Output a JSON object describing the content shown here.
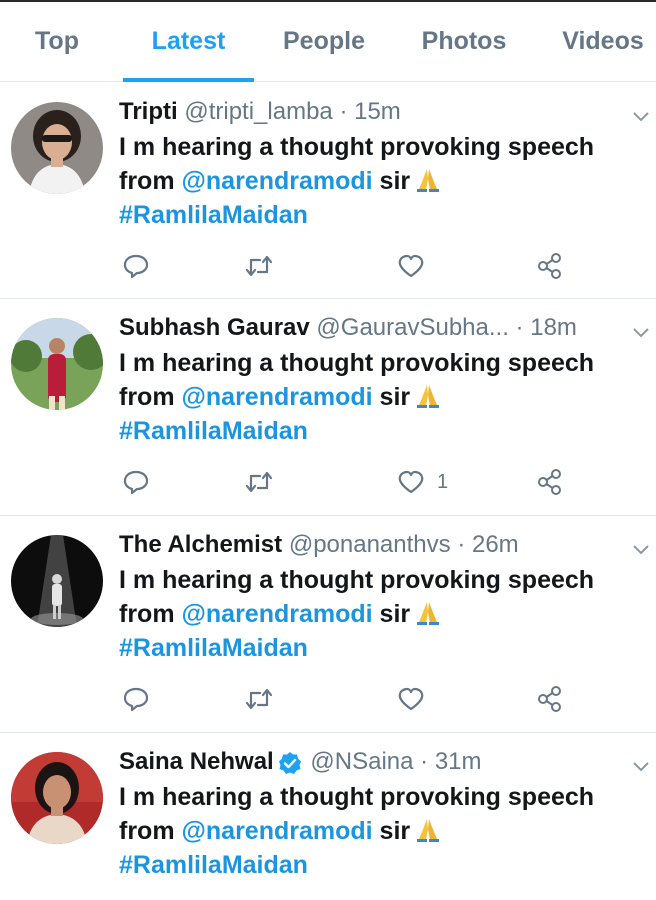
{
  "tabs": [
    {
      "label": "Top",
      "active": false
    },
    {
      "label": "Latest",
      "active": true
    },
    {
      "label": "People",
      "active": false
    },
    {
      "label": "Photos",
      "active": false
    },
    {
      "label": "Videos",
      "active": false
    }
  ],
  "colors": {
    "accent": "#1da1f2",
    "link": "#1b95e0",
    "muted": "#657786",
    "divider": "#e1e8ed",
    "verified": "#1da1f2"
  },
  "tweets": [
    {
      "name": "Tripti",
      "handle": "@tripti_lamba",
      "dot": "·",
      "time": "15m",
      "verified": false,
      "text_1": "I m hearing a thought provoking speech",
      "from": "from",
      "mention": "@narendramodi",
      "sir": "sir",
      "hashtag": "#RamlilaMaidan",
      "emoji": "folded-hands",
      "like_count": ""
    },
    {
      "name": "Subhash Gaurav",
      "handle": "@GauravSubha...",
      "dot": "·",
      "time": "18m",
      "verified": false,
      "text_1": "I m hearing a thought provoking speech",
      "from": "from",
      "mention": "@narendramodi",
      "sir": "sir",
      "hashtag": "#RamlilaMaidan",
      "emoji": "folded-hands",
      "like_count": "1"
    },
    {
      "name": "The Alchemist",
      "handle": "@ponananthvs",
      "dot": "·",
      "time": "26m",
      "verified": false,
      "text_1": "I m hearing a thought provoking speech",
      "from": "from",
      "mention": "@narendramodi",
      "sir": "sir",
      "hashtag": "#RamlilaMaidan",
      "emoji": "folded-hands",
      "like_count": ""
    },
    {
      "name": "Saina Nehwal",
      "handle": "@NSaina",
      "dot": "·",
      "time": "31m",
      "verified": true,
      "text_1": "I m hearing a thought provoking speech",
      "from": "from",
      "mention": "@narendramodi",
      "sir": "sir",
      "hashtag": "#RamlilaMaidan",
      "emoji": "folded-hands",
      "like_count": ""
    }
  ],
  "icons": {
    "reply": "reply-icon",
    "retweet": "retweet-icon",
    "like": "heart-icon",
    "share": "share-icon",
    "more": "chevron-down-icon",
    "verified": "verified-badge-icon"
  }
}
